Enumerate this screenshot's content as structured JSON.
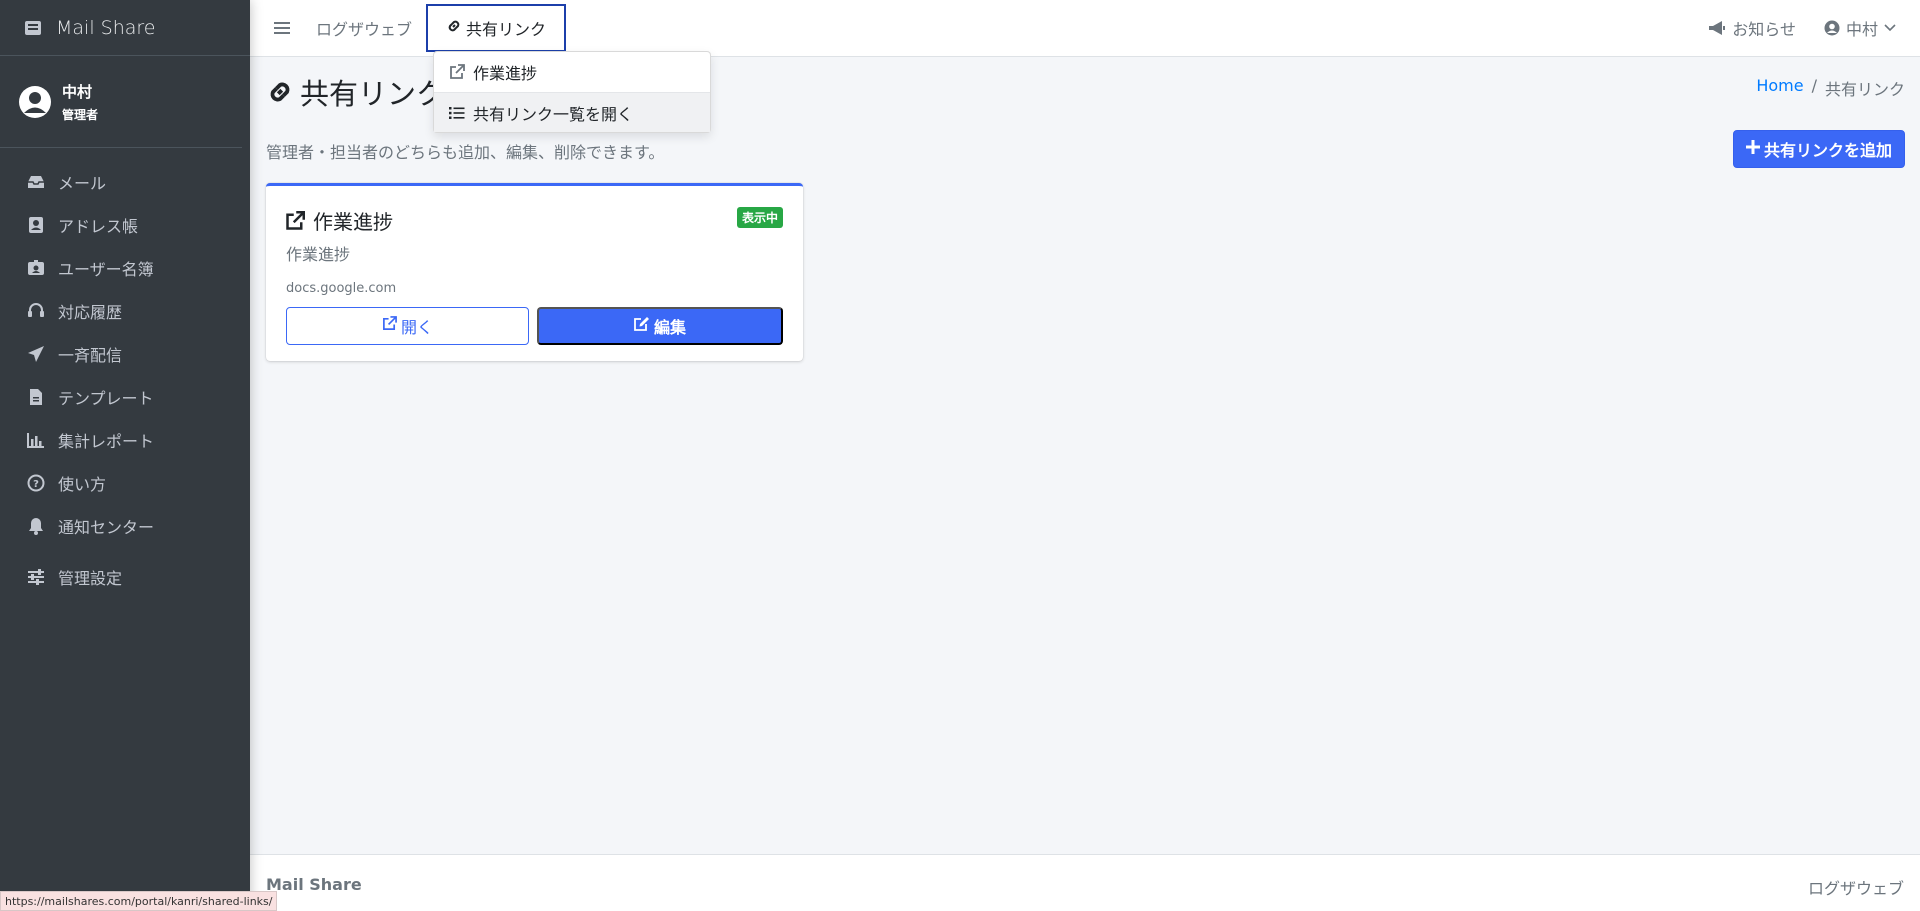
{
  "brand": {
    "name": "Mail Share"
  },
  "user": {
    "name": "中村",
    "role": "管理者"
  },
  "sidebar": {
    "items": [
      {
        "label": "メール",
        "icon": "inbox-icon"
      },
      {
        "label": "アドレス帳",
        "icon": "address-book-icon"
      },
      {
        "label": "ユーザー名簿",
        "icon": "id-badge-icon"
      },
      {
        "label": "対応履歴",
        "icon": "headset-icon"
      },
      {
        "label": "一斉配信",
        "icon": "paper-plane-icon"
      },
      {
        "label": "テンプレート",
        "icon": "file-icon"
      },
      {
        "label": "集計レポート",
        "icon": "chart-bar-icon"
      },
      {
        "label": "使い方",
        "icon": "question-circle-icon"
      },
      {
        "label": "通知センター",
        "icon": "bell-icon"
      },
      {
        "label": "管理設定",
        "icon": "sliders-icon"
      }
    ]
  },
  "topbar": {
    "links": [
      {
        "label": "ログザウェブ"
      },
      {
        "label": "共有リンク"
      }
    ],
    "notice_label": "お知らせ",
    "user_label": "中村"
  },
  "dropdown": {
    "items": [
      {
        "label": "作業進捗",
        "icon": "external-link-icon"
      },
      {
        "label": "共有リンク一覧を開く",
        "icon": "list-icon"
      }
    ]
  },
  "page": {
    "title": "共有リンク",
    "breadcrumb": {
      "home": "Home",
      "separator": "/",
      "current": "共有リンク"
    },
    "description": "管理者・担当者のどちらも追加、編集、削除できます。",
    "add_button": "共有リンクを追加"
  },
  "card": {
    "title": "作業進捗",
    "badge": "表示中",
    "subtitle": "作業進捗",
    "url": "docs.google.com",
    "open_label": "開く",
    "edit_label": "編集"
  },
  "footer": {
    "left": "Mail Share",
    "right": "ログザウェブ"
  },
  "statusbar": {
    "url": "https://mailshares.com/portal/kanri/shared-links/"
  },
  "colors": {
    "accent": "#3b68f6",
    "sidebar_bg": "#343a40",
    "badge_green": "#28a745"
  }
}
